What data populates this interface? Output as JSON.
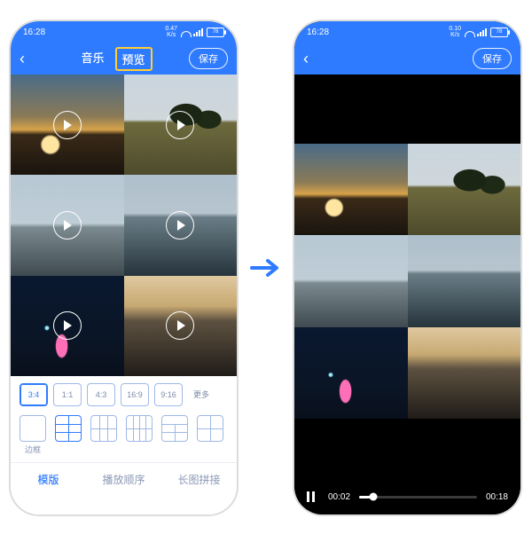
{
  "status": {
    "time": "16:28",
    "kbps_top": "0.47",
    "kbps_unit": "K/s",
    "battery": "78",
    "kbps_top2": "0.10"
  },
  "topL": {
    "tab_music": "音乐",
    "tab_preview": "预览",
    "save": "保存"
  },
  "ratios": [
    "3:4",
    "1:1",
    "4:3",
    "16:9",
    "9:16",
    "更多"
  ],
  "layouts": {
    "border": "边框"
  },
  "bottomTabs": {
    "template": "模版",
    "order": "播放顺序",
    "longimg": "长图拼接"
  },
  "player": {
    "cur": "00:02",
    "total": "00:18"
  }
}
